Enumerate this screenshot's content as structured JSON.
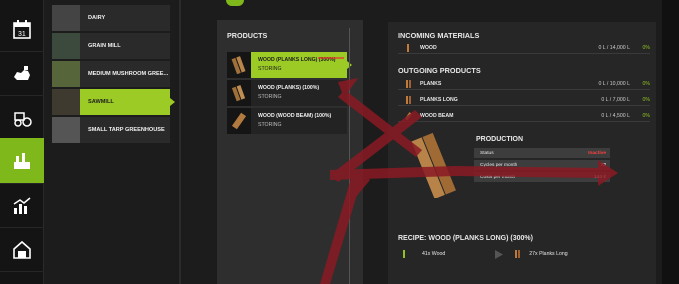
{
  "sidebar": {
    "items": [
      {
        "name": "calendar-icon",
        "active": false
      },
      {
        "name": "animals-icon",
        "active": false
      },
      {
        "name": "tractor-icon",
        "active": false
      },
      {
        "name": "production-icon",
        "active": true
      },
      {
        "name": "stats-icon",
        "active": false
      },
      {
        "name": "building-icon",
        "active": false
      }
    ]
  },
  "productions": {
    "items": [
      {
        "label": "DAIRY",
        "selected": false
      },
      {
        "label": "GRAIN MILL",
        "selected": false
      },
      {
        "label": "MEDIUM MUSHROOM GREE...",
        "selected": false
      },
      {
        "label": "SAWMILL",
        "selected": true
      },
      {
        "label": "SMALL TARP GREENHOUSE",
        "selected": false
      }
    ]
  },
  "products_panel": {
    "title": "PRODUCTS",
    "items": [
      {
        "name": "WOOD (PLANKS LONG) (300%)",
        "status": "STORING",
        "selected": true
      },
      {
        "name": "WOOD (PLANKS) (100%)",
        "status": "STORING",
        "selected": false
      },
      {
        "name": "WOOD (WOOD BEAM) (100%)",
        "status": "STORING",
        "selected": false
      }
    ]
  },
  "incoming": {
    "title": "INCOMING MATERIALS",
    "rows": [
      {
        "name": "WOOD",
        "amount": "0 L / 14,000 L",
        "pct": "0%"
      }
    ]
  },
  "outgoing": {
    "title": "OUTGOING PRODUCTS",
    "rows": [
      {
        "name": "PLANKS",
        "amount": "0 L / 10,000 L",
        "pct": "0%"
      },
      {
        "name": "PLANKS LONG",
        "amount": "0 L / 7,000 L",
        "pct": "0%"
      },
      {
        "name": "WOOD BEAM",
        "amount": "0 L / 4,500 L",
        "pct": "0%"
      }
    ]
  },
  "production": {
    "title": "PRODUCTION",
    "status_label": "Status",
    "status_value": "Inactive",
    "cycles_label": "Cycles per month",
    "cycles_value": "72",
    "costs_label": "Costs per month",
    "costs_value": "144 €"
  },
  "recipe": {
    "title": "RECIPE: WOOD (PLANKS LONG) (300%)",
    "input": "41x Wood",
    "output": "27x Planks Long"
  },
  "colors": {
    "accent": "#9ccb26",
    "arrow": "#8a1a24",
    "status_red": "#ff4040"
  }
}
